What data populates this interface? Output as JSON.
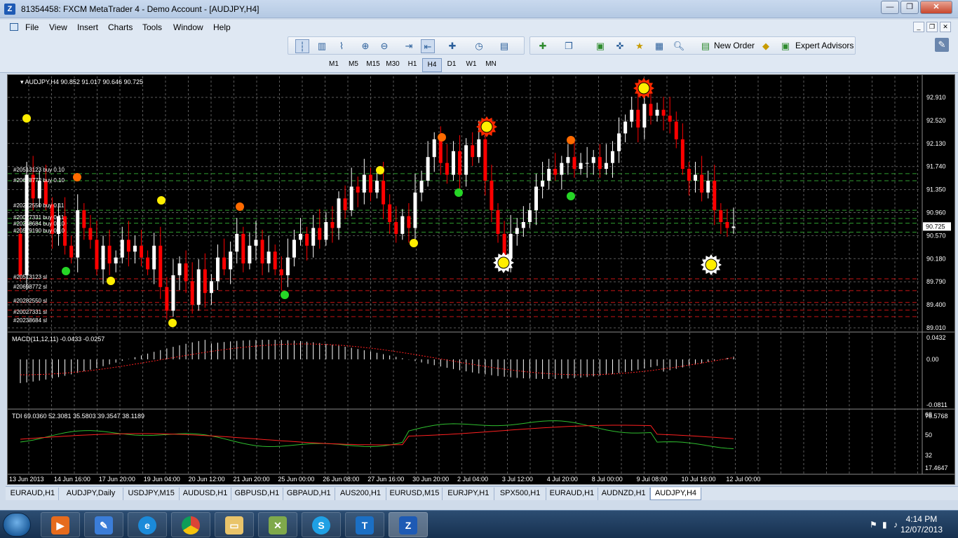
{
  "window": {
    "title": "81354458: FXCM MetaTrader 4 - Demo Account - [AUDJPY,H4]",
    "app_icon": "Z"
  },
  "menu": {
    "items": [
      "File",
      "View",
      "Insert",
      "Charts",
      "Tools",
      "Window",
      "Help"
    ]
  },
  "toolbar": {
    "new_order": "New Order",
    "expert_advisors": "Expert Advisors",
    "timeframes": [
      "M1",
      "M5",
      "M15",
      "M30",
      "H1",
      "H4",
      "D1",
      "W1",
      "MN"
    ],
    "active_timeframe": "H4"
  },
  "chart": {
    "header": "AUDJPY,H4  90.852 91.017 90.646 90.725",
    "current_price": "90.725",
    "price_labels": [
      "92.910",
      "92.520",
      "92.130",
      "91.740",
      "91.350",
      "90.960",
      "90.725",
      "90.570",
      "90.180",
      "89.790",
      "89.400",
      "89.010"
    ],
    "order_labels": [
      "#20513123 buy 0.10",
      "#20698772 buy 0.10",
      "#20282550 buy 0.11",
      "#20027331 buy 0.11",
      "#20238684 buy 0.10",
      "#20579190 buy 0.10"
    ],
    "sl_labels": [
      "#20513123 sl",
      "#20698772 sl",
      "#20282550 sl",
      "#20027331 sl",
      "#20238684 sl"
    ],
    "macd": {
      "label": "MACD(11,12,11) -0.0433 -0.0257",
      "scale": [
        "0.0432",
        "0.00",
        "-0.0811"
      ]
    },
    "tdi": {
      "label": "TDI 69.0360 52.3081 35.5803 39.3547 38.1189",
      "scale": [
        "68",
        "78.5768",
        "50",
        "32",
        "17.4647"
      ]
    },
    "date_labels": [
      "13 Jun 2013",
      "14 Jun 16:00",
      "17 Jun 20:00",
      "19 Jun 04:00",
      "20 Jun 12:00",
      "21 Jun 20:00",
      "25 Jun 00:00",
      "26 Jun 08:00",
      "27 Jun 16:00",
      "30 Jun 20:00",
      "2 Jul 04:00",
      "3 Jul 12:00",
      "4 Jul 20:00",
      "8 Jul 00:00",
      "9 Jul 08:00",
      "10 Jul 16:00",
      "12 Jul 00:00"
    ],
    "colors": {
      "bull": "#ffffff",
      "bear": "#ff0000",
      "grid": "#5a5a5a",
      "buy_line": "#2f9d2f",
      "sl_line": "#c81414"
    }
  },
  "tabs": {
    "items": [
      "EURAUD,H1",
      "AUDJPY,Daily",
      "USDJPY,M15",
      "AUDUSD,H1",
      "GBPUSD,H1",
      "GBPAUD,H1",
      "AUS200,H1",
      "EURUSD,M15",
      "EURJPY,H1",
      "SPX500,H1",
      "EURAUD,H1",
      "AUDNZD,H1",
      "AUDJPY,H4"
    ],
    "active": "AUDJPY,H4"
  },
  "taskbar": {
    "time": "4:14 PM",
    "date": "12/07/2013"
  }
}
